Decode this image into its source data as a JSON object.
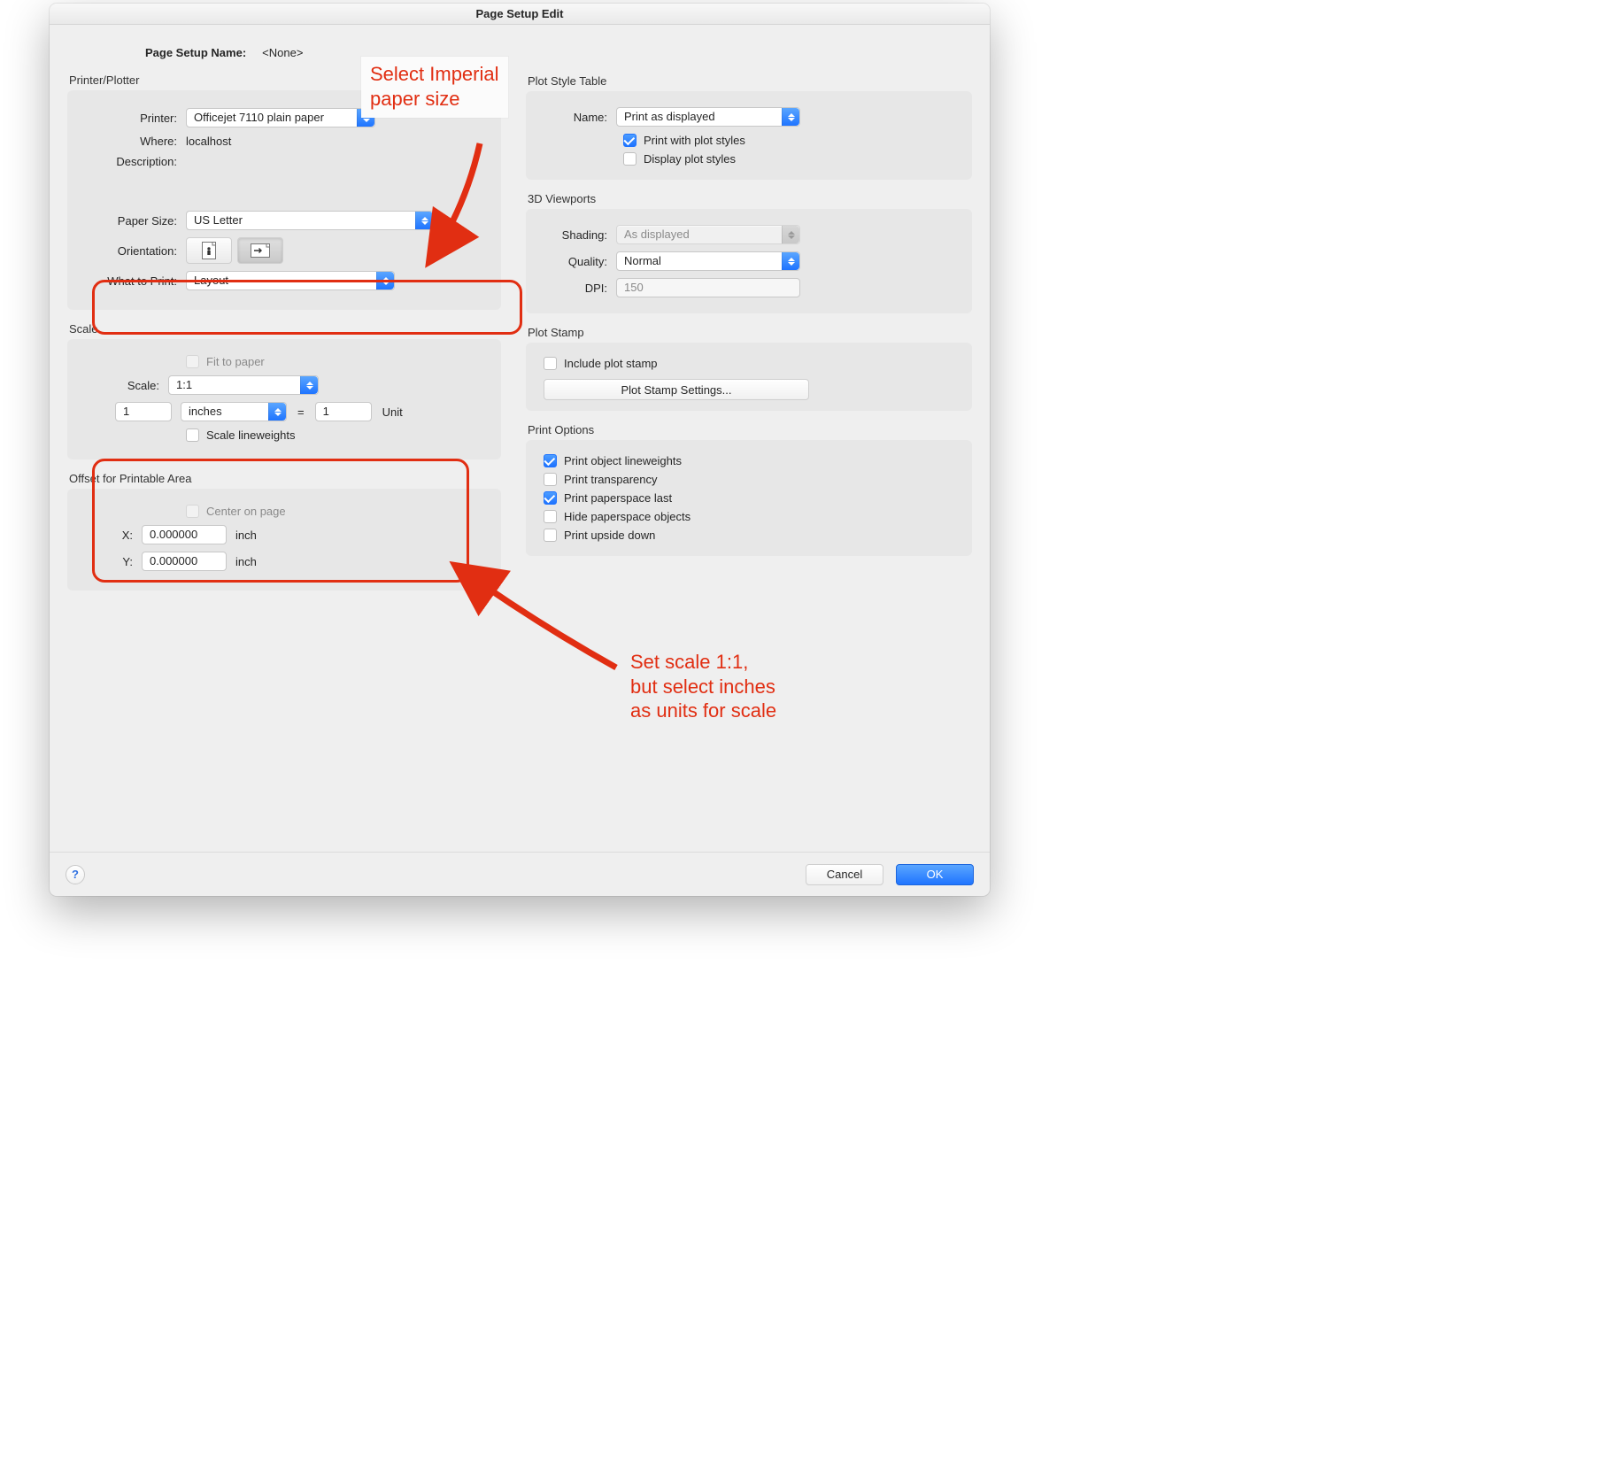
{
  "window": {
    "title": "Page Setup Edit"
  },
  "header": {
    "page_setup_name_label": "Page Setup Name:",
    "page_setup_name_value": "<None>"
  },
  "printer_plotter": {
    "group_label": "Printer/Plotter",
    "printer_label": "Printer:",
    "printer_value": "Officejet 7110 plain paper",
    "where_label": "Where:",
    "where_value": "localhost",
    "description_label": "Description:",
    "paper_size_label": "Paper Size:",
    "paper_size_value": "US Letter",
    "orientation_label": "Orientation:",
    "what_to_print_label": "What to Print:",
    "what_to_print_value": "Layout"
  },
  "scale": {
    "group_label": "Scale",
    "fit_to_paper_label": "Fit to paper",
    "scale_label": "Scale:",
    "scale_value": "1:1",
    "value_left": "1",
    "unit_select": "inches",
    "equals": "=",
    "value_right": "1",
    "unit_label": "Unit",
    "scale_lineweights_label": "Scale lineweights"
  },
  "offset": {
    "group_label": "Offset for Printable Area",
    "center_label": "Center on page",
    "x_label": "X:",
    "x_value": "0.000000",
    "y_label": "Y:",
    "y_value": "0.000000",
    "unit": "inch"
  },
  "plot_style": {
    "group_label": "Plot Style Table",
    "name_label": "Name:",
    "name_value": "Print as displayed",
    "print_with_styles_label": "Print with plot styles",
    "display_styles_label": "Display plot styles"
  },
  "viewports": {
    "group_label": "3D Viewports",
    "shading_label": "Shading:",
    "shading_value": "As displayed",
    "quality_label": "Quality:",
    "quality_value": "Normal",
    "dpi_label": "DPI:",
    "dpi_value": "150"
  },
  "plot_stamp": {
    "group_label": "Plot Stamp",
    "include_label": "Include plot stamp",
    "settings_label": "Plot Stamp Settings..."
  },
  "print_options": {
    "group_label": "Print Options",
    "object_lineweights": "Print object lineweights",
    "transparency": "Print transparency",
    "paperspace_last": "Print paperspace last",
    "hide_paperspace": "Hide paperspace objects",
    "upside_down": "Print upside down"
  },
  "buttons": {
    "cancel": "Cancel",
    "ok": "OK",
    "help": "?"
  },
  "annotations": {
    "top": "Select Imperial\npaper size",
    "bottom": "Set scale 1:1,\nbut select inches\nas units for scale",
    "color": "#e12e12"
  }
}
